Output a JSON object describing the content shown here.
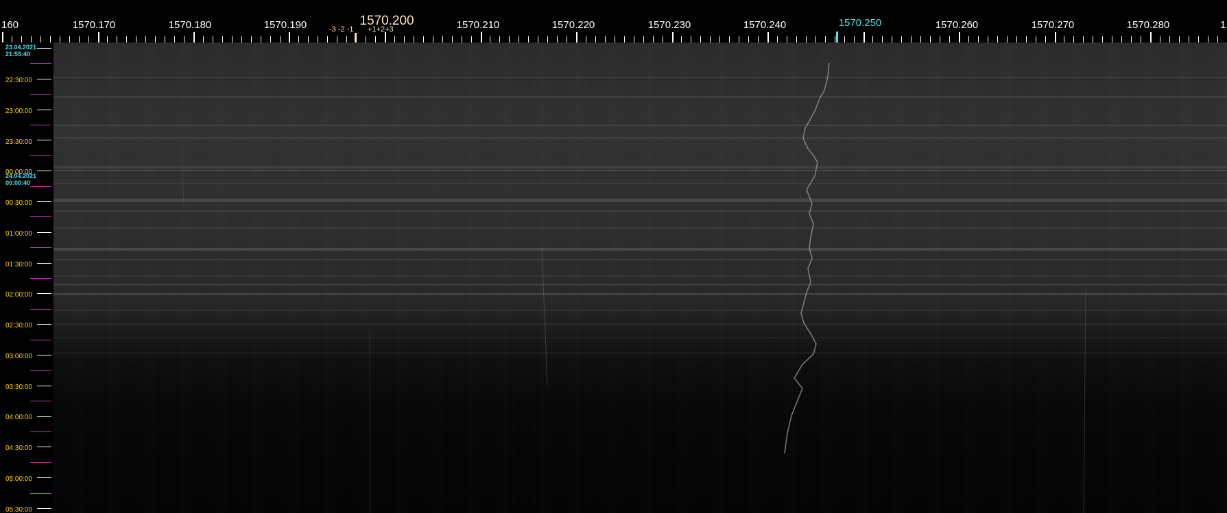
{
  "frequency_scale": {
    "left_edge_label": "160",
    "right_edge_label": "1",
    "labels": [
      "1570.170",
      "1570.180",
      "1570.190",
      "1570.210",
      "1570.220",
      "1570.230",
      "1570.240",
      "1570.260",
      "1570.270",
      "1570.280"
    ],
    "center_label": "1570.200",
    "cursor_label": "1570.250",
    "offset_left": "-3 -2 -1",
    "offset_right": "+1+2+3"
  },
  "time_axis": {
    "start_date": "23.04.2021",
    "start_time": "21:55:40",
    "midnight_label": "00:00:00",
    "next_date": "24.04.2021",
    "next_time": "00:00:40",
    "labels": [
      "22:30:00",
      "23:00:00",
      "23:30:00",
      "00:30:00",
      "01:00:00",
      "01:30:00",
      "02:00:00",
      "02:30:00",
      "03:00:00",
      "03:30:00",
      "04:00:00",
      "04:30:00",
      "05:00:00",
      "05:30:00"
    ]
  },
  "colors": {
    "background": "#000000",
    "scale_text": "#ffffff",
    "center_frequency": "#ffe4b5",
    "cursor": "#4fe0ea",
    "time_labels": "#ffd700",
    "date_labels": "#4fe0ea",
    "half_hour_marker": "#c040c0"
  }
}
